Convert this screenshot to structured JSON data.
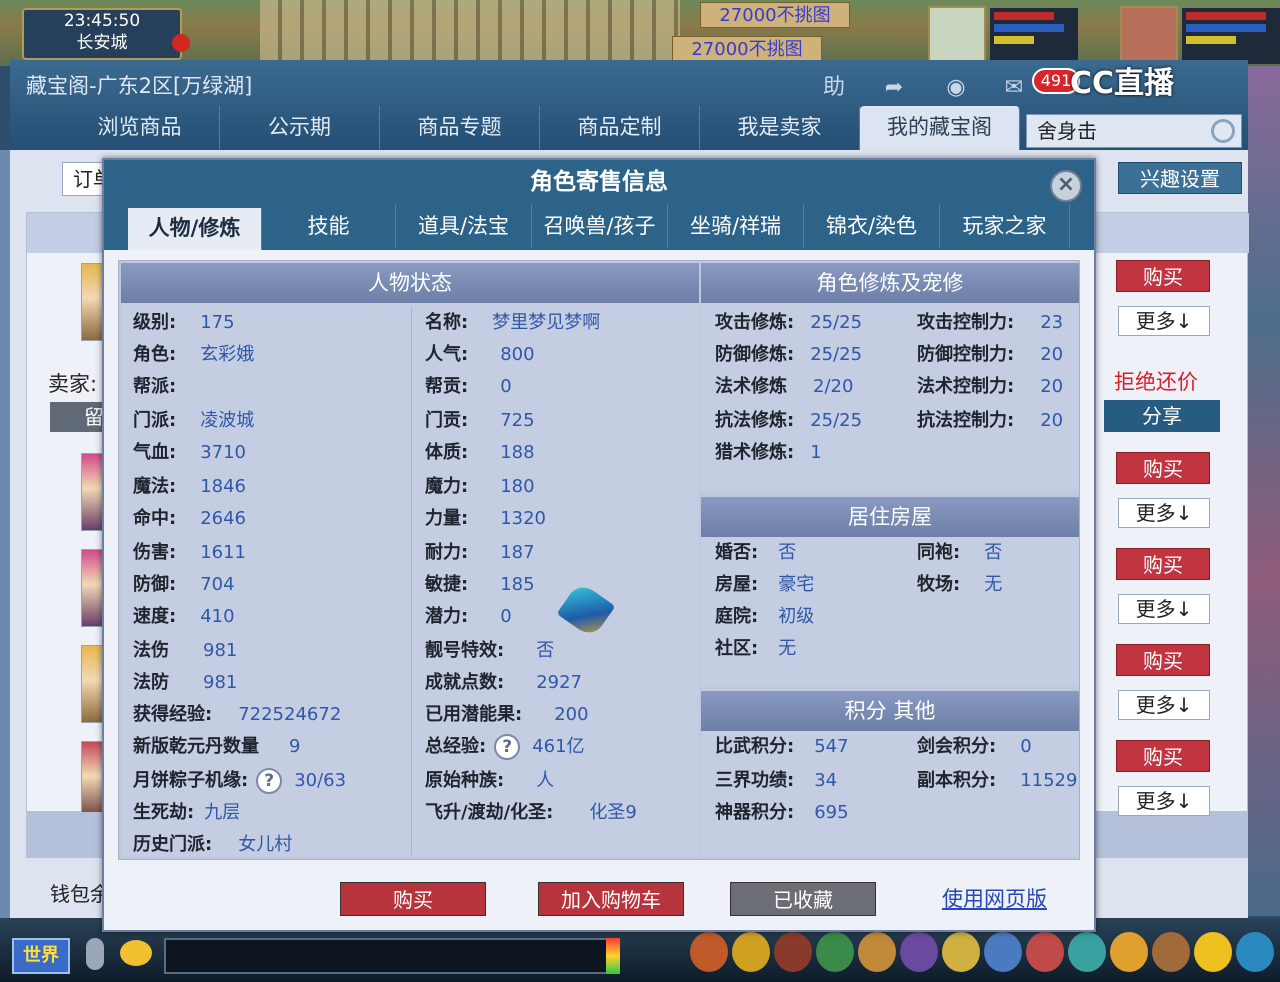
{
  "game": {
    "clock": "23:45:50",
    "location": "长安城",
    "banner1": "27000不挑图",
    "banner2": "27000不挑图",
    "stream_logo": "CC直播"
  },
  "store": {
    "title": "藏宝阁-广东2区[万绿湖]",
    "header_buttons": [
      "助"
    ],
    "message_count": "491",
    "nav": [
      "浏览商品",
      "公示期",
      "商品专题",
      "商品定制",
      "我是卖家",
      "我的藏宝阁"
    ],
    "nav_active": 5,
    "search_value": "舍身击",
    "order_tab": "订单",
    "interest_button": "兴趣设置",
    "seller_label": "卖家:",
    "seller_btn": "留",
    "wallet_label": "钱包余",
    "reject_bargain": "拒绝还价",
    "share": "分享",
    "buy": "购买",
    "more": "更多↓"
  },
  "bottom_bar": {
    "world": "世界"
  },
  "modal": {
    "title": "角色寄售信息",
    "close": "×",
    "tabs": [
      "人物/修炼",
      "技能",
      "道具/法宝",
      "召唤兽/孩子",
      "坐骑/祥瑞",
      "锦衣/染色",
      "玩家之家"
    ],
    "char_status": {
      "title": "人物状态",
      "left": [
        {
          "label": "级别:",
          "value": "175"
        },
        {
          "label": "角色:",
          "value": "玄彩娥"
        },
        {
          "label": "帮派:",
          "value": ""
        },
        {
          "label": "门派:",
          "value": "凌波城"
        },
        {
          "label": "气血:",
          "value": "3710"
        },
        {
          "label": "魔法:",
          "value": "1846"
        },
        {
          "label": "命中:",
          "value": "2646"
        },
        {
          "label": "伤害:",
          "value": "1611"
        },
        {
          "label": "防御:",
          "value": "704"
        },
        {
          "label": "速度:",
          "value": "410"
        },
        {
          "label": "法伤",
          "value": "981"
        },
        {
          "label": "法防",
          "value": "981"
        },
        {
          "label": "获得经验:",
          "value": "722524672"
        },
        {
          "label": "新版乾元丹数量",
          "value": "9"
        },
        {
          "label": "月饼粽子机缘:",
          "value": "30/63"
        },
        {
          "label": "生死劫:",
          "value": "九层"
        },
        {
          "label": "历史门派:",
          "value": "女儿村"
        }
      ],
      "right": [
        {
          "label": "名称:",
          "value": "梦里梦见梦啊"
        },
        {
          "label": "人气:",
          "value": "800"
        },
        {
          "label": "帮贡:",
          "value": "0"
        },
        {
          "label": "门贡:",
          "value": "725"
        },
        {
          "label": "体质:",
          "value": "188"
        },
        {
          "label": "魔力:",
          "value": "180"
        },
        {
          "label": "力量:",
          "value": "1320"
        },
        {
          "label": "耐力:",
          "value": "187"
        },
        {
          "label": "敏捷:",
          "value": "185"
        },
        {
          "label": "潜力:",
          "value": "0"
        },
        {
          "label": "靓号特效:",
          "value": "否"
        },
        {
          "label": "成就点数:",
          "value": "2927"
        },
        {
          "label": "已用潜能果:",
          "value": "200"
        },
        {
          "label": "总经验:",
          "value": "461亿"
        },
        {
          "label": "原始种族:",
          "value": "人"
        },
        {
          "label": "飞升/渡劫/化圣:",
          "value": "化圣9"
        }
      ]
    },
    "cultivation": {
      "title": "角色修炼及宠修",
      "left": [
        {
          "label": "攻击修炼:",
          "value": "25/25"
        },
        {
          "label": "防御修炼:",
          "value": "25/25"
        },
        {
          "label": "法术修炼",
          "value": "2/20"
        },
        {
          "label": "抗法修炼:",
          "value": "25/25"
        },
        {
          "label": "猎术修炼:",
          "value": "1"
        }
      ],
      "right": [
        {
          "label": "攻击控制力:",
          "value": "23"
        },
        {
          "label": "防御控制力:",
          "value": "20"
        },
        {
          "label": "法术控制力:",
          "value": "20"
        },
        {
          "label": "抗法控制力:",
          "value": "20"
        }
      ]
    },
    "housing": {
      "title": "居住房屋",
      "left": [
        {
          "label": "婚否:",
          "value": "否"
        },
        {
          "label": "房屋:",
          "value": "豪宅"
        },
        {
          "label": "庭院:",
          "value": "初级"
        },
        {
          "label": "社区:",
          "value": "无"
        }
      ],
      "right": [
        {
          "label": "同袍:",
          "value": "否"
        },
        {
          "label": "牧场:",
          "value": "无"
        }
      ]
    },
    "points": {
      "title": "积分 其他",
      "left": [
        {
          "label": "比武积分:",
          "value": "547"
        },
        {
          "label": "三界功绩:",
          "value": "34"
        },
        {
          "label": "神器积分:",
          "value": "695"
        }
      ],
      "right": [
        {
          "label": "剑会积分:",
          "value": "0"
        },
        {
          "label": "副本积分:",
          "value": "11529"
        }
      ]
    },
    "buttons": {
      "buy": "购买",
      "add_cart": "加入购物车",
      "favorited": "已收藏",
      "web_version": "使用网页版"
    }
  }
}
